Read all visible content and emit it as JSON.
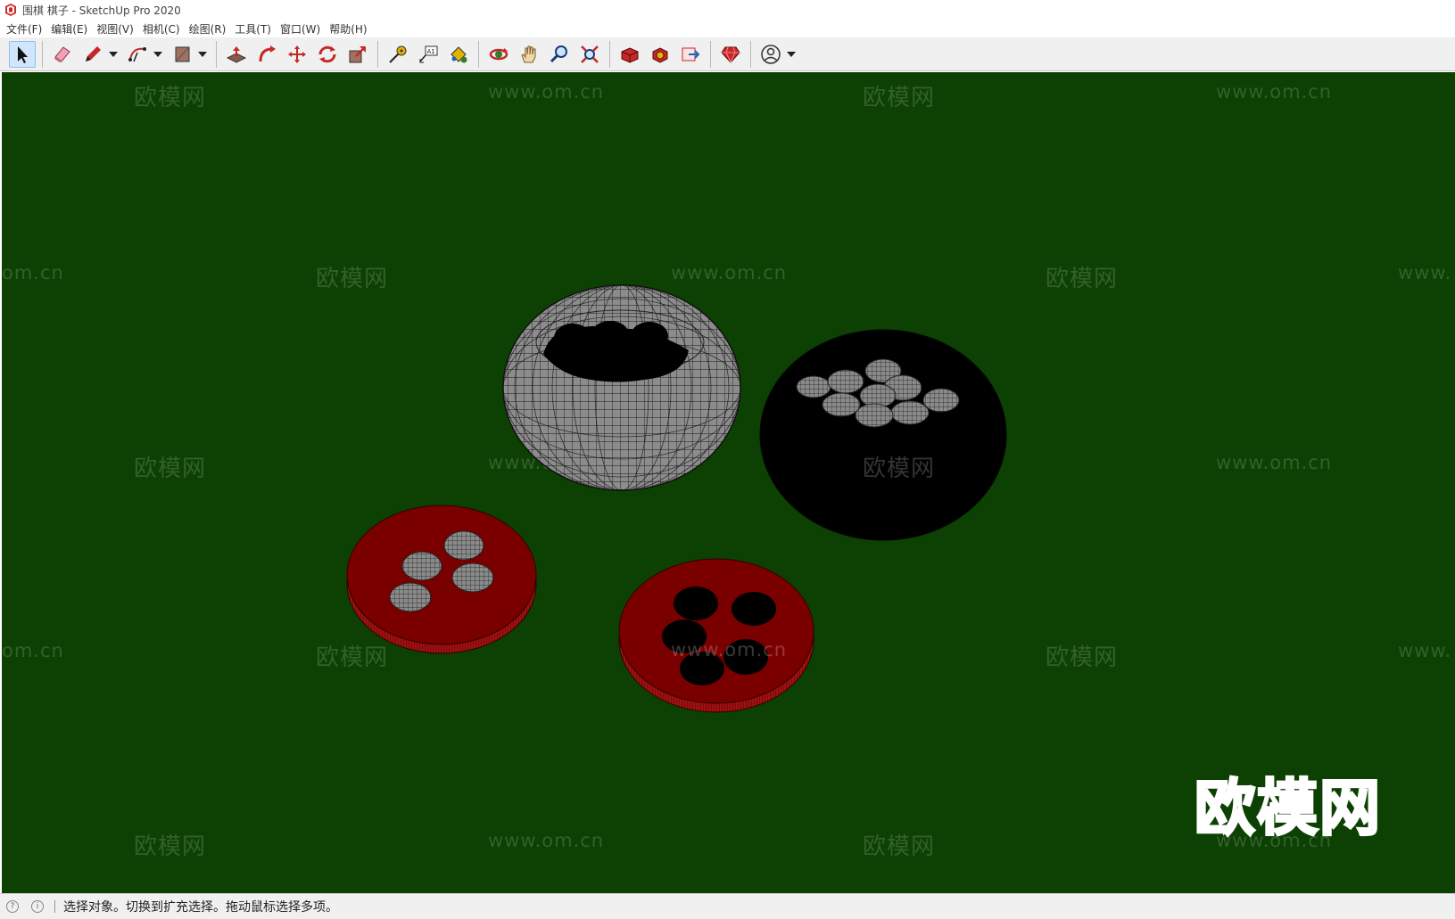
{
  "window": {
    "title": "围棋 棋子 - SketchUp Pro 2020"
  },
  "menu": {
    "items": [
      {
        "label": "文件(F)"
      },
      {
        "label": "编辑(E)"
      },
      {
        "label": "视图(V)"
      },
      {
        "label": "相机(C)"
      },
      {
        "label": "绘图(R)"
      },
      {
        "label": "工具(T)"
      },
      {
        "label": "窗口(W)"
      },
      {
        "label": "帮助(H)"
      }
    ]
  },
  "toolbar": {
    "tools": [
      "select-icon",
      "eraser-icon",
      "pencil-icon",
      "arc-icon",
      "shape-icon",
      "push-pull-icon",
      "follow-me-icon",
      "move-icon",
      "rotate-icon",
      "scale-icon",
      "tape-measure-icon",
      "text-icon",
      "paint-bucket-icon",
      "orbit-icon",
      "pan-icon",
      "zoom-icon",
      "zoom-extents-icon",
      "warehouse-icon",
      "extension-icon",
      "send-to-layout-icon",
      "ruby-icon",
      "account-icon"
    ],
    "text_tool_glyph": "A1"
  },
  "viewport": {
    "background": "#0c4103",
    "watermark_brand": "欧模网",
    "watermark_url": "www.om.cn",
    "watermark_url_cut_left": "om.cn",
    "watermark_url_cut_right": "www.",
    "logo_text": "欧模网",
    "colors": {
      "lid_red": "#7a0000",
      "lid_edge": "#9a1010",
      "white_stone": "#7d7d7d",
      "black_stone": "#000000",
      "bowl_grey": "#8a8a8a"
    }
  },
  "status": {
    "text": "选择对象。切换到扩充选择。拖动鼠标选择多项。"
  }
}
